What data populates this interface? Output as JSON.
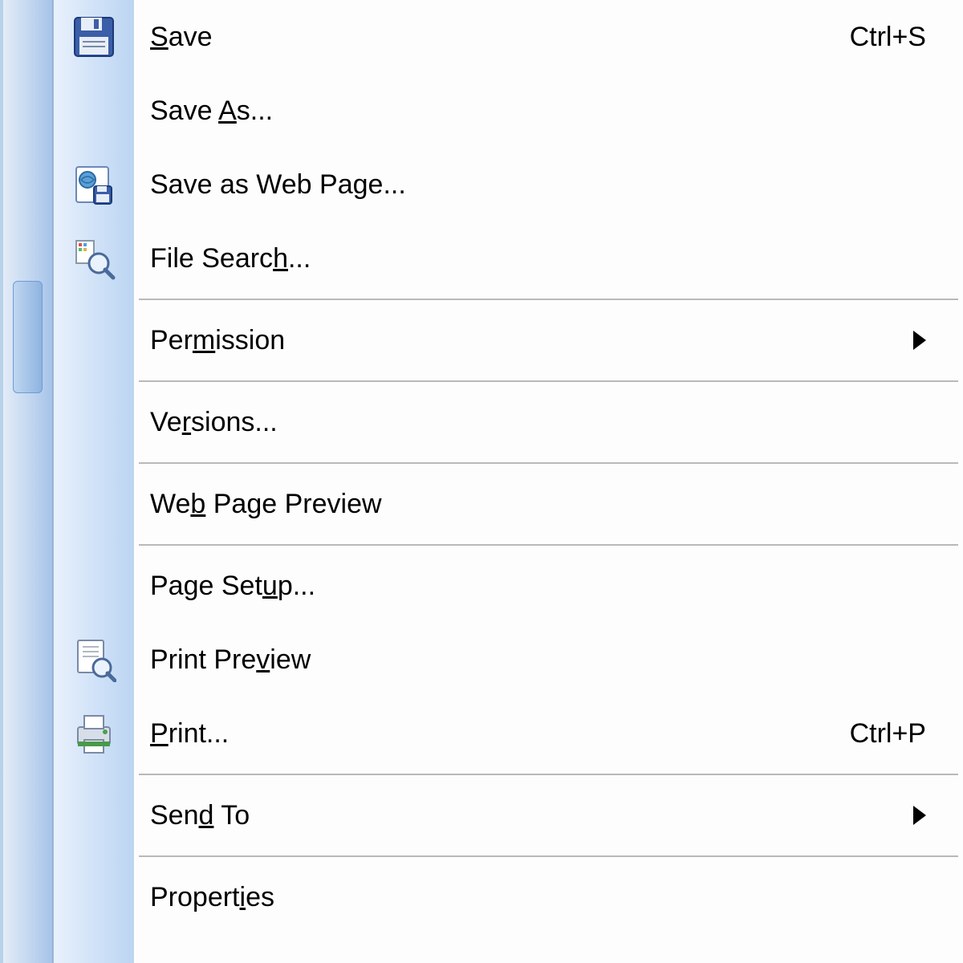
{
  "menu": {
    "items": [
      {
        "id": "save",
        "label_pre": "",
        "accel": "S",
        "label_post": "ave",
        "shortcut": "Ctrl+S",
        "icon": "floppy-icon"
      },
      {
        "id": "save-as",
        "label_pre": "Save ",
        "accel": "A",
        "label_post": "s...",
        "shortcut": "",
        "icon": ""
      },
      {
        "id": "save-as-web",
        "label_pre": "Save as Web Page...",
        "accel": "",
        "label_post": "",
        "shortcut": "",
        "icon": "web-save-icon"
      },
      {
        "id": "file-search",
        "label_pre": "File Searc",
        "accel": "h",
        "label_post": "...",
        "shortcut": "",
        "icon": "file-search-icon",
        "sep_after": true
      },
      {
        "id": "permission",
        "label_pre": "Per",
        "accel": "m",
        "label_post": "ission",
        "shortcut": "",
        "icon": "",
        "submenu": true,
        "sep_after": true
      },
      {
        "id": "versions",
        "label_pre": "Ve",
        "accel": "r",
        "label_post": "sions...",
        "shortcut": "",
        "icon": "",
        "sep_after": true
      },
      {
        "id": "web-page-preview",
        "label_pre": "We",
        "accel": "b",
        "label_post": " Page Preview",
        "shortcut": "",
        "icon": "",
        "sep_after": true
      },
      {
        "id": "page-setup",
        "label_pre": "Page Set",
        "accel": "u",
        "label_post": "p...",
        "shortcut": "",
        "icon": ""
      },
      {
        "id": "print-preview",
        "label_pre": "Print Pre",
        "accel": "v",
        "label_post": "iew",
        "shortcut": "",
        "icon": "print-preview-icon"
      },
      {
        "id": "print",
        "label_pre": "",
        "accel": "P",
        "label_post": "rint...",
        "shortcut": "Ctrl+P",
        "icon": "printer-icon",
        "sep_after": true
      },
      {
        "id": "send-to",
        "label_pre": "Sen",
        "accel": "d",
        "label_post": " To",
        "shortcut": "",
        "icon": "",
        "submenu": true,
        "sep_after": true
      },
      {
        "id": "properties",
        "label_pre": "Propert",
        "accel": "i",
        "label_post": "es",
        "shortcut": "",
        "icon": ""
      }
    ]
  }
}
